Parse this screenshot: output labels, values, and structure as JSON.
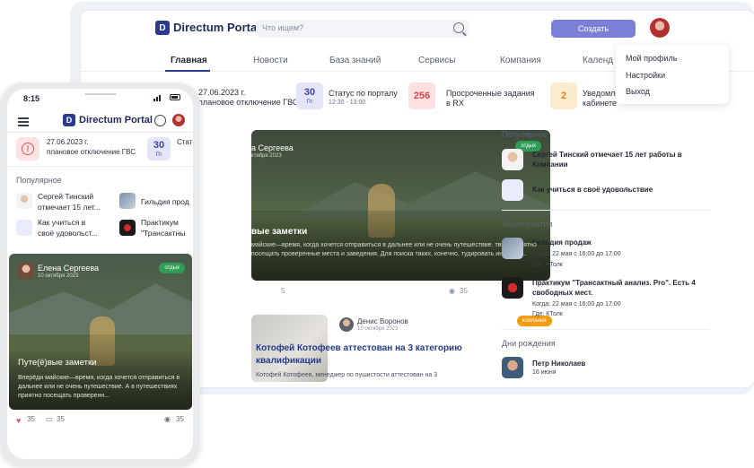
{
  "desktop": {
    "brand": "Directum Portal",
    "logo_letter": "D",
    "search_placeholder": "Что ищем?",
    "create_label": "Создать",
    "nav": [
      "Главная",
      "Новости",
      "База знаний",
      "Сервисы",
      "Компания",
      "Календ"
    ],
    "user_menu": [
      "Мой профиль",
      "Настройки",
      "Выход"
    ],
    "notifications": [
      {
        "line1": "27.06.2023 г.",
        "line2": "плановое отключение ГВС"
      },
      {
        "tile": "30",
        "tile_sub": "Пт",
        "line1": "Статус по порталу",
        "line2": "12:30 - 13:00"
      },
      {
        "tile": "256",
        "line1": "Просроченные задания",
        "line2": "в RX"
      },
      {
        "tile": "2",
        "line1": "Уведомлен",
        "line2": "кабинете"
      }
    ],
    "feed_card": {
      "author": "а Сергеева",
      "date": "ктября 2023",
      "badge": "отдых",
      "title": "вые заметки",
      "text": "майские—время, когда хочется отправиться в дальнее или не очень путешествие. твиях приятно посещать проверенные места и заведения. Для поиска таких, конечно, тудировать интернет..."
    },
    "feed_meta": {
      "count_left": "5",
      "views": "35"
    },
    "post2": {
      "author": "Денис Воронов",
      "date": "10 октября 2023",
      "badge": "компания",
      "title": "Котофей Котофеев аттестован на 3 категорию квалификации",
      "text": "Котофей Котофеев, менеджер по пушистости аттестован на 3"
    },
    "sidebar": {
      "popular_title": "Популярное",
      "popular": [
        {
          "text": "Сергей Тинский отмечает 15 лет работы в Компании"
        },
        {
          "text": "Как учиться в своё удовольствие"
        }
      ],
      "events_title": "Мероприятия",
      "events": [
        {
          "title": "Гильдия продаж",
          "when": "Когда: 22 мая с 16:00 до 17:00",
          "where": "Где: КТолк"
        },
        {
          "title": "Практикум \"Трансактный анализ. Pro\". Есть 4 свободных мест.",
          "when": "Когда: 22 мая с 16:00 до 17:00",
          "where": "Где: КТолк"
        }
      ],
      "birthdays_title": "Дни рождения",
      "birthdays": [
        {
          "name": "Петр Николаев",
          "date": "16 июня"
        }
      ]
    }
  },
  "phone": {
    "time": "8:15",
    "brand": "Directum Portal",
    "logo_letter": "D",
    "notifications": [
      {
        "line1": "27.06.2023 г.",
        "line2": "плановое отключение ГВС"
      },
      {
        "tile": "30",
        "tile_sub": "Пт",
        "line1": "Стат"
      }
    ],
    "popular_title": "Популярное",
    "popular": [
      {
        "line1": "Сергей Тинский",
        "line2": "отмечает 15 лет..."
      },
      {
        "line1": "Гильдия прод",
        "line2": ""
      },
      {
        "line1": "Как учиться в",
        "line2": "своё удовольст..."
      },
      {
        "line1": "Практикум",
        "line2": "\"Трансактны"
      }
    ],
    "card": {
      "author": "Елена Сергеева",
      "date": "10 октября 2023",
      "badge": "отдых",
      "title": "Путе(ё)вые заметки",
      "text": "Вперёди майские—время, когда хочется отправиться в дальнее или не очень путешествие. А в путешествиях приятно посещать проверенн..."
    },
    "footer": {
      "likes": "35",
      "comments": "35",
      "views": "35"
    }
  }
}
